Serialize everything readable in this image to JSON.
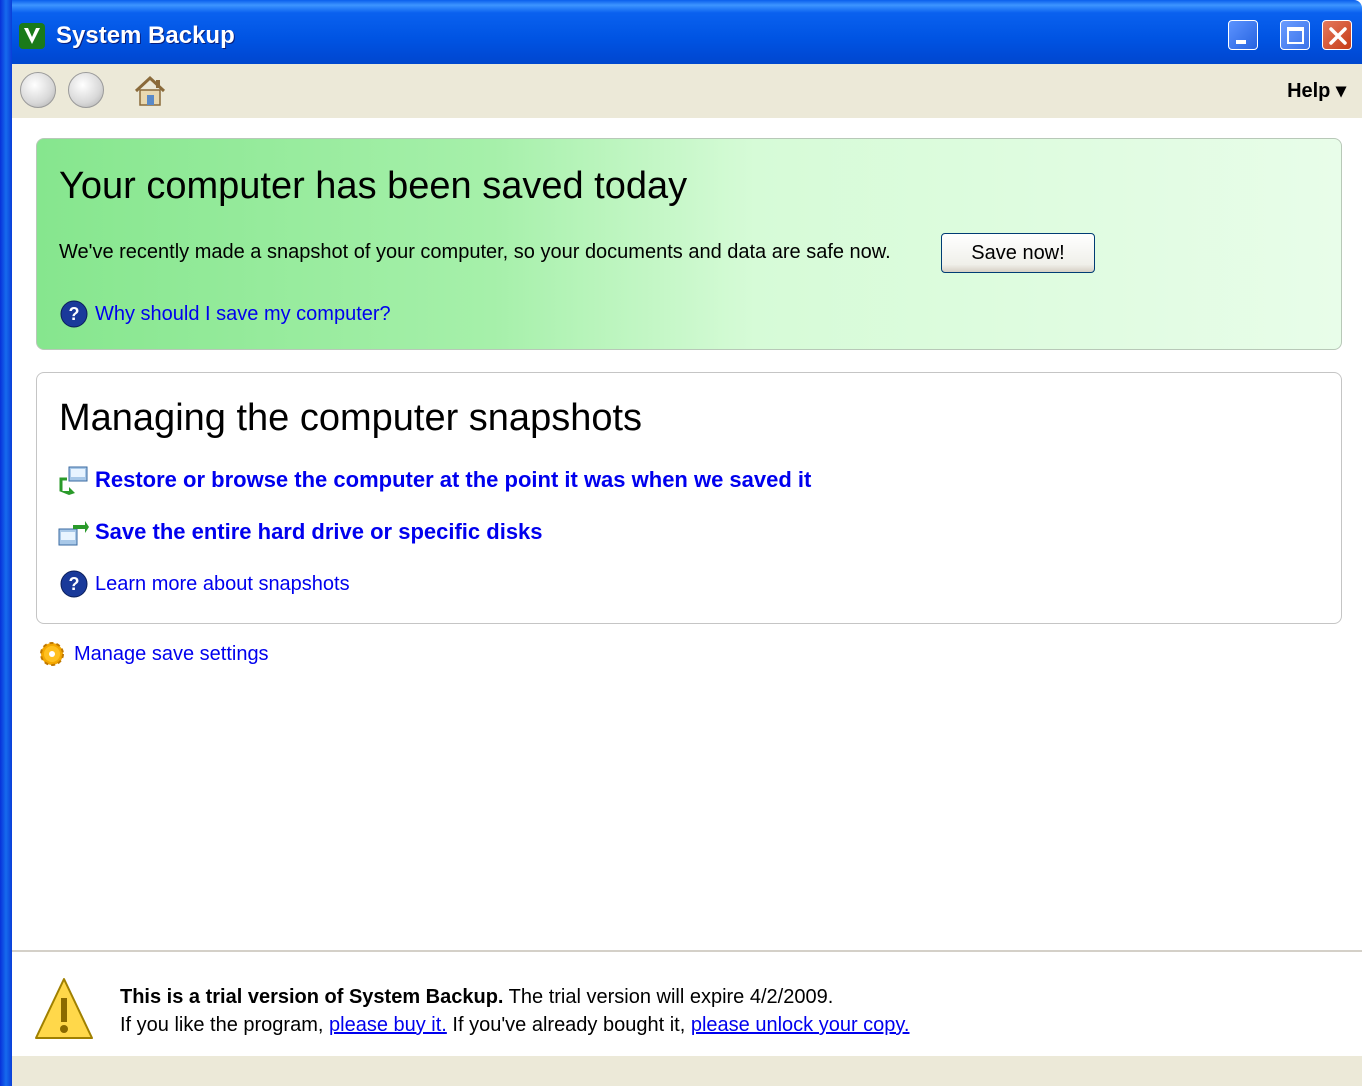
{
  "window": {
    "title": "System Backup",
    "icon": "app-v-icon",
    "controls": [
      "minimize-icon",
      "maximize-icon",
      "close-icon"
    ]
  },
  "toolbar": {
    "back_icon": "back-arrow-icon",
    "forward_icon": "forward-arrow-icon",
    "home_icon": "home-icon",
    "help_label": "Help ▾"
  },
  "status_panel": {
    "title": "Your computer has been saved today",
    "description": "We've recently made a snapshot of your computer, so your documents and data are safe now.",
    "save_button": "Save now!",
    "why_link": "Why should I save my computer?"
  },
  "snapshots_panel": {
    "title": "Managing the computer snapshots",
    "restore_link": "Restore or browse the computer at the point it was when we saved it",
    "save_disks_link": "Save the entire hard drive or specific disks",
    "learn_link": "Learn more about snapshots"
  },
  "settings_link": "Manage save settings",
  "trial": {
    "bold_text": "This is a trial version of System Backup.",
    "expire_text": "The trial version will expire 4/2/2009.",
    "line2_prefix": "If you like the program,",
    "buy_link": "please buy it.",
    "line2_middle": "If you've already bought it,",
    "unlock_link": "please unlock your copy."
  },
  "colors": {
    "title_bar": "#0054e3",
    "link": "#0000ee",
    "panel_green": "#a6f0aa",
    "chrome": "#ece9d8"
  }
}
